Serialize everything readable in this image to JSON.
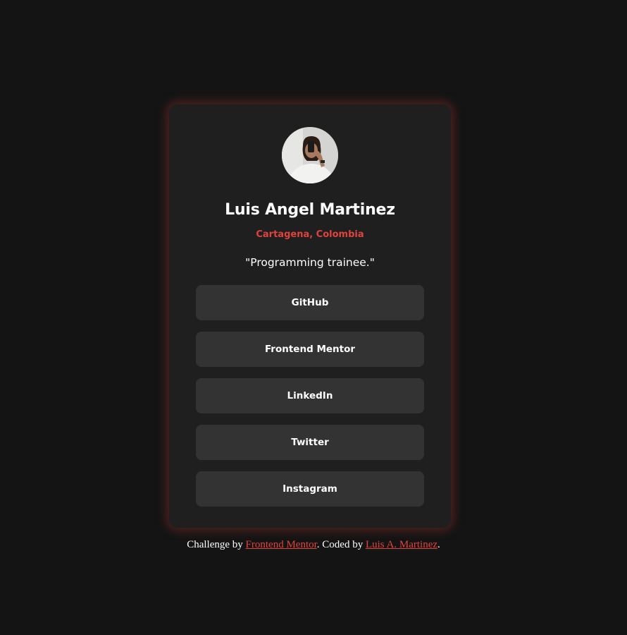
{
  "theme": {
    "accent": "#e0433d",
    "background": "#141414",
    "card": "#1f1f1f",
    "button": "#333333",
    "text": "#ffffff"
  },
  "profile": {
    "avatar_icon": "profile-photo",
    "name": "Luis Angel Martinez",
    "location": "Cartagena, Colombia",
    "bio": "\"Programming trainee.\""
  },
  "links": [
    {
      "label": "GitHub"
    },
    {
      "label": "Frontend Mentor"
    },
    {
      "label": "LinkedIn"
    },
    {
      "label": "Twitter"
    },
    {
      "label": "Instagram"
    }
  ],
  "attribution": {
    "prefix": "Challenge by ",
    "challenge_link": "Frontend Mentor",
    "middle": ". Coded by ",
    "author_link": "Luis A. Martinez",
    "suffix": "."
  }
}
